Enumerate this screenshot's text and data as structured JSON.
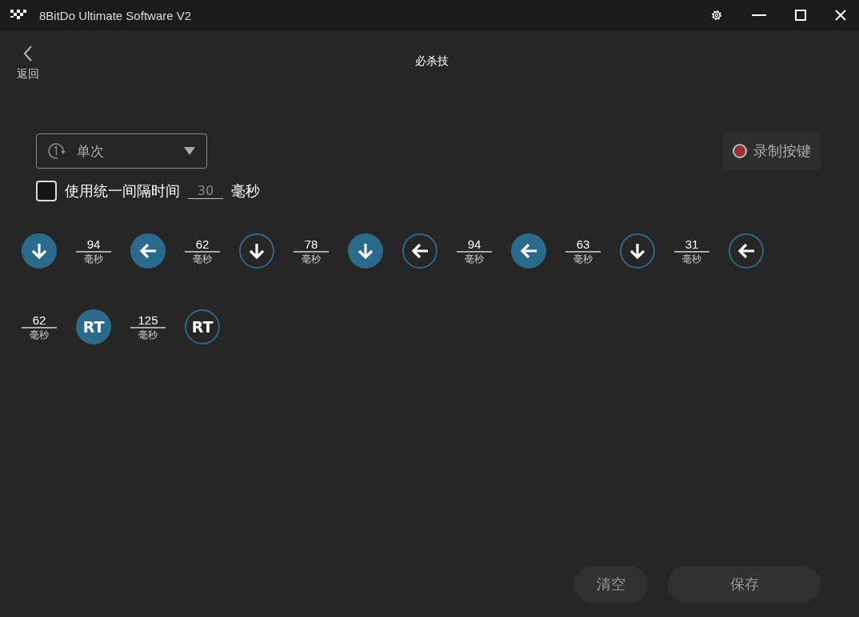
{
  "window": {
    "title": "8BitDo Ultimate Software V2"
  },
  "header": {
    "back_label": "返回",
    "title": "必杀技"
  },
  "mode_dropdown": {
    "value": "单次"
  },
  "record_button": {
    "label": "录制按键"
  },
  "uniform_interval": {
    "checked": false,
    "label": "使用统一间隔时间",
    "placeholder": "30",
    "unit": "毫秒"
  },
  "steps": [
    {
      "kind": "down",
      "pressed": true
    },
    {
      "kind": "delay",
      "value": "94",
      "unit": "毫秒"
    },
    {
      "kind": "left",
      "pressed": true
    },
    {
      "kind": "delay",
      "value": "62",
      "unit": "毫秒"
    },
    {
      "kind": "down",
      "pressed": false
    },
    {
      "kind": "delay",
      "value": "78",
      "unit": "毫秒"
    },
    {
      "kind": "down",
      "pressed": true
    },
    {
      "kind": "left",
      "pressed": false
    },
    {
      "kind": "delay",
      "value": "94",
      "unit": "毫秒"
    },
    {
      "kind": "left",
      "pressed": true
    },
    {
      "kind": "delay",
      "value": "63",
      "unit": "毫秒"
    },
    {
      "kind": "down",
      "pressed": false
    },
    {
      "kind": "delay",
      "value": "31",
      "unit": "毫秒"
    },
    {
      "kind": "left",
      "pressed": false
    },
    {
      "kind": "delay",
      "value": "62",
      "unit": "毫秒"
    },
    {
      "kind": "label",
      "label": "RT",
      "pressed": true
    },
    {
      "kind": "delay",
      "value": "125",
      "unit": "毫秒"
    },
    {
      "kind": "label",
      "label": "RT",
      "pressed": false
    }
  ],
  "buttons": {
    "clear": "清空",
    "save": "保存"
  }
}
